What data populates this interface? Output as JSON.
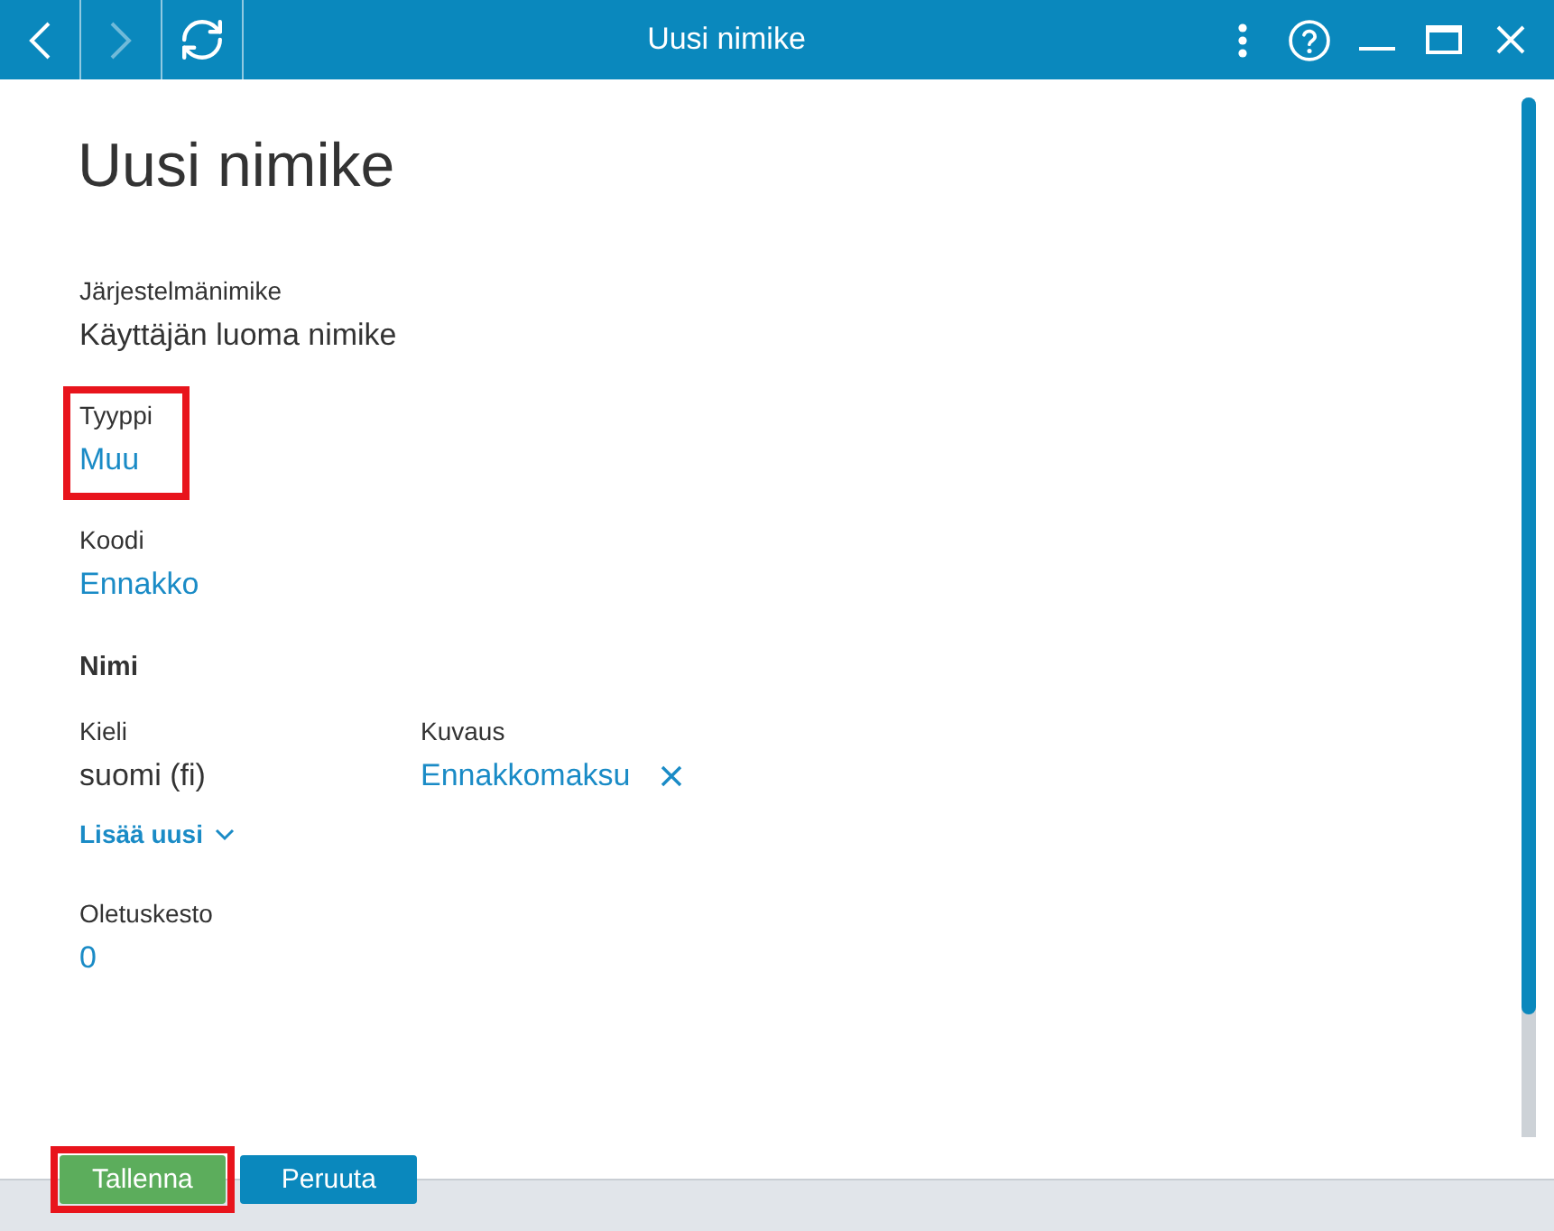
{
  "window": {
    "title": "Uusi nimike",
    "nav": [
      {
        "kind": "back",
        "disabled": false
      },
      {
        "kind": "forward",
        "disabled": true
      },
      {
        "kind": "refresh",
        "disabled": false
      }
    ],
    "controls": [
      {
        "kind": "more"
      },
      {
        "kind": "help"
      },
      {
        "kind": "minimize"
      },
      {
        "kind": "maximize"
      },
      {
        "kind": "close"
      }
    ]
  },
  "page": {
    "heading": "Uusi nimike"
  },
  "fields": [
    {
      "label": "Järjestelmänimike",
      "value": "Käyttäjän luoma nimike",
      "kind": "text",
      "highlighted": false
    },
    {
      "label": "Tyyppi",
      "value": "Muu",
      "kind": "link",
      "highlighted": true
    },
    {
      "label": "Koodi",
      "value": "Ennakko",
      "kind": "link",
      "highlighted": false
    }
  ],
  "names": {
    "title": "Nimi",
    "columns": [
      "Kieli",
      "Kuvaus"
    ],
    "rows": [
      {
        "language": "suomi (fi)",
        "description": "Ennakkomaksu",
        "removable": true
      }
    ],
    "add_link": "Lisää uusi"
  },
  "fields_after": [
    {
      "label": "Oletuskesto",
      "value": "0",
      "kind": "link",
      "highlighted": false
    }
  ],
  "buttons": [
    {
      "label": "Tallenna",
      "kind": "primary",
      "highlighted": true
    },
    {
      "label": "Peruuta",
      "kind": "secondary",
      "highlighted": false
    }
  ]
}
